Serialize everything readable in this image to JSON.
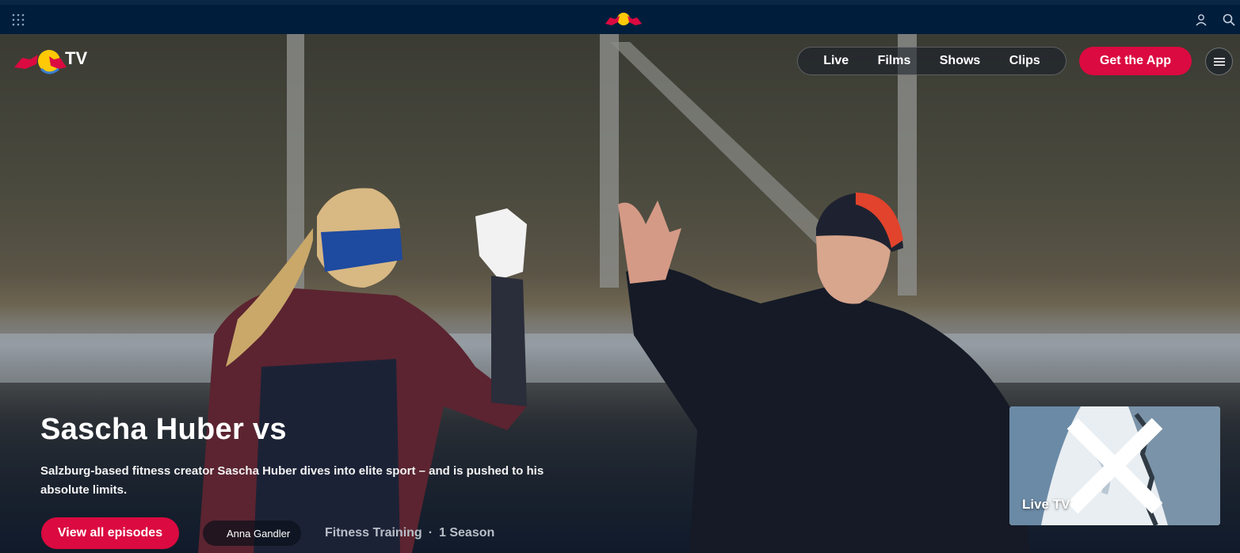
{
  "topbar": {
    "icons": [
      "grid-icon",
      "red-bull-logo",
      "user-icon",
      "search-icon"
    ]
  },
  "header": {
    "logo_text": "TV",
    "nav": [
      {
        "label": "Live"
      },
      {
        "label": "Films"
      },
      {
        "label": "Shows"
      },
      {
        "label": "Clips"
      }
    ],
    "get_app_label": "Get the App",
    "menu_icon": "hamburger-icon"
  },
  "hero": {
    "title": "Sascha Huber vs",
    "description": "Salzburg-based fitness creator Sascha Huber dives into elite sport – and is pushed to his absolute limits.",
    "cta_label": "View all episodes",
    "person": "Anna Gandler",
    "category": "Fitness Training",
    "separator": "·",
    "seasons": "1 Season"
  },
  "live_player": {
    "label": "Live TV",
    "close_icon": "close-icon"
  },
  "colors": {
    "brand_red": "#db0a40",
    "topbar_bg": "#001e3c"
  }
}
